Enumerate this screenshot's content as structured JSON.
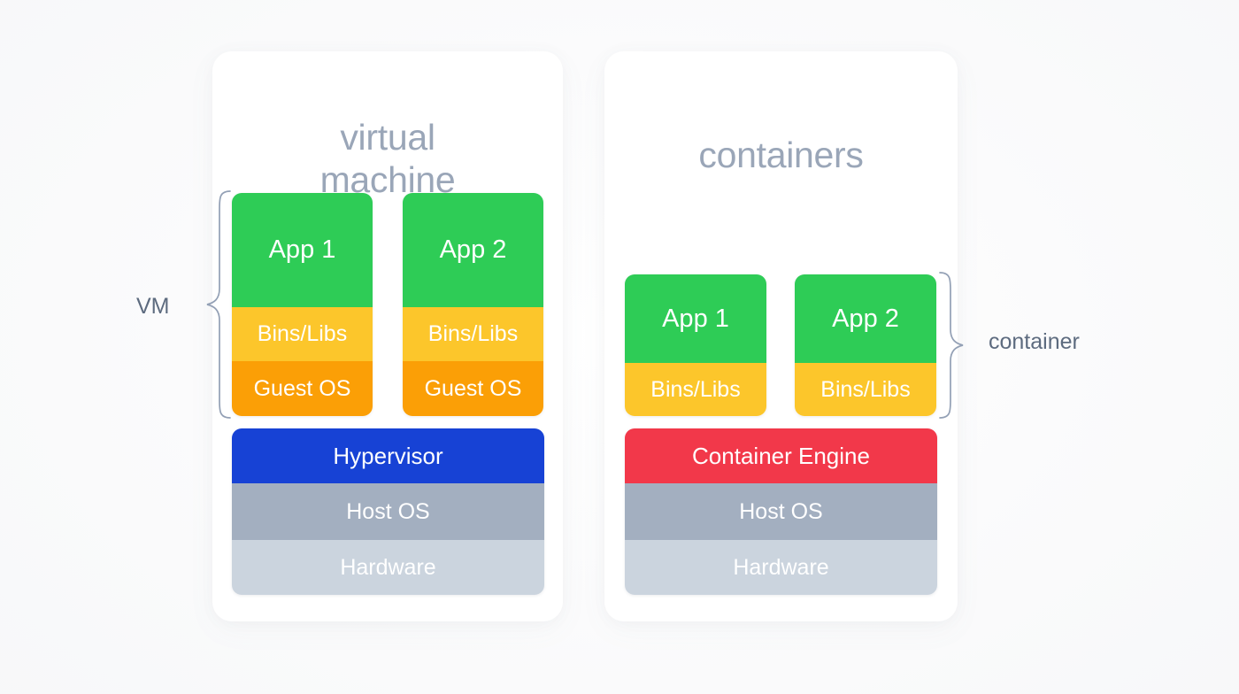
{
  "diagram": {
    "title_left": "virtual\nmachine",
    "title_right": "containers",
    "annotations": {
      "left_brace_label": "VM",
      "right_brace_label": "container"
    }
  },
  "panels": {
    "vm": {
      "title": "virtual\nmachine",
      "stacks": [
        {
          "name": "vm-stack-1",
          "layers": [
            {
              "label": "App 1",
              "color": "#2ECC56",
              "role": "application"
            },
            {
              "label": "Bins/Libs",
              "color": "#FCC62B",
              "role": "libraries"
            },
            {
              "label": "Guest OS",
              "color": "#FB9F06",
              "role": "guest-os"
            }
          ]
        },
        {
          "name": "vm-stack-2",
          "layers": [
            {
              "label": "App 2",
              "color": "#2ECC56",
              "role": "application"
            },
            {
              "label": "Bins/Libs",
              "color": "#FCC62B",
              "role": "libraries"
            },
            {
              "label": "Guest OS",
              "color": "#FB9F06",
              "role": "guest-os"
            }
          ]
        }
      ],
      "base_layers": [
        {
          "label": "Hypervisor",
          "color": "#1742D5",
          "role": "hypervisor"
        },
        {
          "label": "Host OS",
          "color": "#A3AFC0",
          "role": "host-os"
        },
        {
          "label": "Hardware",
          "color": "#CBD4DE",
          "role": "hardware"
        }
      ]
    },
    "containers": {
      "title": "containers",
      "stacks": [
        {
          "name": "ct-stack-1",
          "layers": [
            {
              "label": "App 1",
              "color": "#2ECC56",
              "role": "application"
            },
            {
              "label": "Bins/Libs",
              "color": "#FCC62B",
              "role": "libraries"
            }
          ]
        },
        {
          "name": "ct-stack-2",
          "layers": [
            {
              "label": "App 2",
              "color": "#2ECC56",
              "role": "application"
            },
            {
              "label": "Bins/Libs",
              "color": "#FCC62B",
              "role": "libraries"
            }
          ]
        }
      ],
      "base_layers": [
        {
          "label": "Container Engine",
          "color": "#F2384A",
          "role": "container-engine"
        },
        {
          "label": "Host OS",
          "color": "#A3AFC0",
          "role": "host-os"
        },
        {
          "label": "Hardware",
          "color": "#CBD4DE",
          "role": "hardware"
        }
      ]
    }
  },
  "colors": {
    "background": "#FAFAFA",
    "card": "#FFFFFF",
    "title_text": "#9AA6B8",
    "annotation_text": "#5D6B7F",
    "brace_stroke": "#93A0B5",
    "app_green": "#2ECC56",
    "bins_yellow": "#FCC62B",
    "guest_orange": "#FB9F06",
    "hypervisor_blue": "#1742D5",
    "engine_red": "#F2384A",
    "host_gray": "#A3AFC0",
    "hardware_gray": "#CBD4DE"
  }
}
